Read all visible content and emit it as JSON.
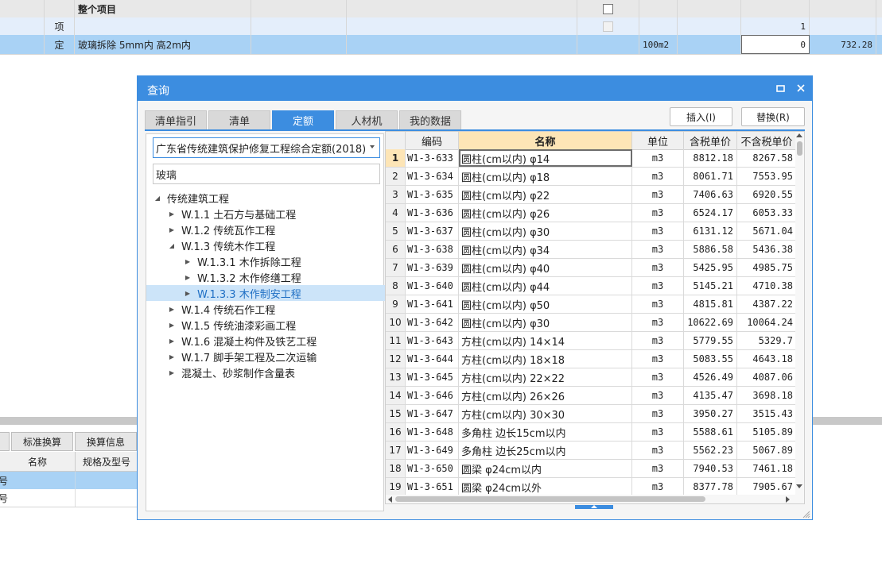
{
  "background_sheet": {
    "rows": [
      {
        "type": "",
        "name": "整个项目",
        "unit": "",
        "qty": "",
        "price": ""
      },
      {
        "type": "项",
        "name": "",
        "unit": "",
        "qty": "1",
        "price": ""
      },
      {
        "type": "定",
        "name": "玻璃拆除 5mm内 高2m内",
        "unit": "100m2",
        "qty": "0",
        "price": "732.28"
      }
    ]
  },
  "lower_panel": {
    "tabs": [
      "标准换算",
      "换算信息"
    ],
    "headers": [
      "名称",
      "规格及型号"
    ],
    "row_marks": [
      "号",
      "号"
    ]
  },
  "dialog": {
    "title": "查询",
    "tabs": [
      "清单指引",
      "清单",
      "定额",
      "人材机",
      "我的数据"
    ],
    "active_tab": 2,
    "insert_label": "插入(I)",
    "replace_label": "替换(R)",
    "quota_library": "广东省传统建筑保护修复工程综合定额(2018)",
    "search_value": "玻璃",
    "tree": [
      {
        "label": "传统建筑工程",
        "level": 0,
        "expanded": true,
        "selected": false
      },
      {
        "label": "W.1.1 土石方与基础工程",
        "level": 1,
        "expanded": false,
        "selected": false
      },
      {
        "label": "W.1.2 传统瓦作工程",
        "level": 1,
        "expanded": false,
        "selected": false
      },
      {
        "label": "W.1.3 传统木作工程",
        "level": 1,
        "expanded": true,
        "selected": false
      },
      {
        "label": "W.1.3.1 木作拆除工程",
        "level": 2,
        "expanded": false,
        "selected": false
      },
      {
        "label": "W.1.3.2 木作修缮工程",
        "level": 2,
        "expanded": false,
        "selected": false
      },
      {
        "label": "W.1.3.3 木作制安工程",
        "level": 2,
        "expanded": false,
        "selected": true
      },
      {
        "label": "W.1.4 传统石作工程",
        "level": 1,
        "expanded": false,
        "selected": false
      },
      {
        "label": "W.1.5 传统油漆彩画工程",
        "level": 1,
        "expanded": false,
        "selected": false
      },
      {
        "label": "W.1.6 混凝土构件及铁艺工程",
        "level": 1,
        "expanded": false,
        "selected": false
      },
      {
        "label": "W.1.7 脚手架工程及二次运输",
        "level": 1,
        "expanded": false,
        "selected": false
      },
      {
        "label": "混凝土、砂浆制作含量表",
        "level": 1,
        "expanded": false,
        "selected": false
      }
    ],
    "table": {
      "headers": [
        "编码",
        "名称",
        "单位",
        "含税单价",
        "不含税单价"
      ],
      "rows": [
        [
          "1",
          "W1-3-633",
          "圆柱(cm以内) φ14",
          "m3",
          "8812.18",
          "8267.58"
        ],
        [
          "2",
          "W1-3-634",
          "圆柱(cm以内) φ18",
          "m3",
          "8061.71",
          "7553.95"
        ],
        [
          "3",
          "W1-3-635",
          "圆柱(cm以内) φ22",
          "m3",
          "7406.63",
          "6920.55"
        ],
        [
          "4",
          "W1-3-636",
          "圆柱(cm以内) φ26",
          "m3",
          "6524.17",
          "6053.33"
        ],
        [
          "5",
          "W1-3-637",
          "圆柱(cm以内) φ30",
          "m3",
          "6131.12",
          "5671.04"
        ],
        [
          "6",
          "W1-3-638",
          "圆柱(cm以内) φ34",
          "m3",
          "5886.58",
          "5436.38"
        ],
        [
          "7",
          "W1-3-639",
          "圆柱(cm以内) φ40",
          "m3",
          "5425.95",
          "4985.75"
        ],
        [
          "8",
          "W1-3-640",
          "圆柱(cm以内) φ44",
          "m3",
          "5145.21",
          "4710.38"
        ],
        [
          "9",
          "W1-3-641",
          "圆柱(cm以内) φ50",
          "m3",
          "4815.81",
          "4387.22"
        ],
        [
          "10",
          "W1-3-642",
          "圆柱(cm以内) φ30",
          "m3",
          "10622.69",
          "10064.24"
        ],
        [
          "11",
          "W1-3-643",
          "方柱(cm以内) 14×14",
          "m3",
          "5779.55",
          "5329.7"
        ],
        [
          "12",
          "W1-3-644",
          "方柱(cm以内) 18×18",
          "m3",
          "5083.55",
          "4643.18"
        ],
        [
          "13",
          "W1-3-645",
          "方柱(cm以内) 22×22",
          "m3",
          "4526.49",
          "4087.06"
        ],
        [
          "14",
          "W1-3-646",
          "方柱(cm以内) 26×26",
          "m3",
          "4135.47",
          "3698.18"
        ],
        [
          "15",
          "W1-3-647",
          "方柱(cm以内) 30×30",
          "m3",
          "3950.27",
          "3515.43"
        ],
        [
          "16",
          "W1-3-648",
          "多角柱 边长15cm以内",
          "m3",
          "5588.61",
          "5105.89"
        ],
        [
          "17",
          "W1-3-649",
          "多角柱 边长25cm以内",
          "m3",
          "5562.23",
          "5067.89"
        ],
        [
          "18",
          "W1-3-650",
          "圆梁 φ24cm以内",
          "m3",
          "7940.53",
          "7461.18"
        ],
        [
          "19",
          "W1-3-651",
          "圆梁 φ24cm以外",
          "m3",
          "8377.78",
          "7905.67"
        ]
      ]
    }
  },
  "colors": {
    "accent": "#3c8de0",
    "header_highlight": "#fde5b6",
    "selected_row": "#a9d2f5"
  }
}
